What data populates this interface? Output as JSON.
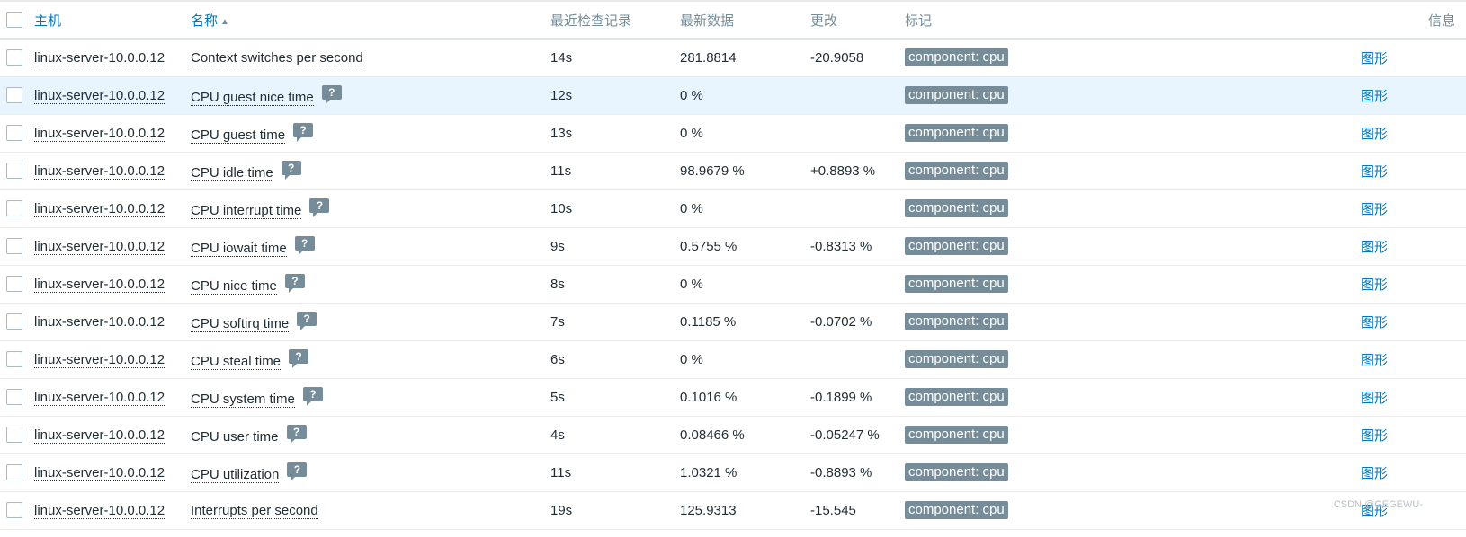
{
  "colors": {
    "link": "#0275b8",
    "header_text": "#768d99",
    "tag_bg": "#768d99",
    "row_hover": "#e8f5ff",
    "text": "#1f2c33"
  },
  "table": {
    "headers": {
      "host": "主机",
      "name": "名称",
      "name_sort_arrow": "▲",
      "last_check": "最近检查记录",
      "last_value": "最新数据",
      "change": "更改",
      "tags": "标记",
      "info": "信息"
    },
    "rows": [
      {
        "host": "linux-server-10.0.0.12",
        "name": "Context switches per second",
        "has_hint": false,
        "last_check": "14s",
        "last_value": "281.8814",
        "change": "-20.9058",
        "tag": "component: cpu",
        "graph": "图形"
      },
      {
        "host": "linux-server-10.0.0.12",
        "name": "CPU guest nice time",
        "has_hint": true,
        "last_check": "12s",
        "last_value": "0 %",
        "change": "",
        "tag": "component: cpu",
        "graph": "图形"
      },
      {
        "host": "linux-server-10.0.0.12",
        "name": "CPU guest time",
        "has_hint": true,
        "last_check": "13s",
        "last_value": "0 %",
        "change": "",
        "tag": "component: cpu",
        "graph": "图形"
      },
      {
        "host": "linux-server-10.0.0.12",
        "name": "CPU idle time",
        "has_hint": true,
        "last_check": "11s",
        "last_value": "98.9679 %",
        "change": "+0.8893 %",
        "tag": "component: cpu",
        "graph": "图形"
      },
      {
        "host": "linux-server-10.0.0.12",
        "name": "CPU interrupt time",
        "has_hint": true,
        "last_check": "10s",
        "last_value": "0 %",
        "change": "",
        "tag": "component: cpu",
        "graph": "图形"
      },
      {
        "host": "linux-server-10.0.0.12",
        "name": "CPU iowait time",
        "has_hint": true,
        "last_check": "9s",
        "last_value": "0.5755 %",
        "change": "-0.8313 %",
        "tag": "component: cpu",
        "graph": "图形"
      },
      {
        "host": "linux-server-10.0.0.12",
        "name": "CPU nice time",
        "has_hint": true,
        "last_check": "8s",
        "last_value": "0 %",
        "change": "",
        "tag": "component: cpu",
        "graph": "图形"
      },
      {
        "host": "linux-server-10.0.0.12",
        "name": "CPU softirq time",
        "has_hint": true,
        "last_check": "7s",
        "last_value": "0.1185 %",
        "change": "-0.0702 %",
        "tag": "component: cpu",
        "graph": "图形"
      },
      {
        "host": "linux-server-10.0.0.12",
        "name": "CPU steal time",
        "has_hint": true,
        "last_check": "6s",
        "last_value": "0 %",
        "change": "",
        "tag": "component: cpu",
        "graph": "图形"
      },
      {
        "host": "linux-server-10.0.0.12",
        "name": "CPU system time",
        "has_hint": true,
        "last_check": "5s",
        "last_value": "0.1016 %",
        "change": "-0.1899 %",
        "tag": "component: cpu",
        "graph": "图形"
      },
      {
        "host": "linux-server-10.0.0.12",
        "name": "CPU user time",
        "has_hint": true,
        "last_check": "4s",
        "last_value": "0.08466 %",
        "change": "-0.05247 %",
        "tag": "component: cpu",
        "graph": "图形"
      },
      {
        "host": "linux-server-10.0.0.12",
        "name": "CPU utilization",
        "has_hint": true,
        "last_check": "11s",
        "last_value": "1.0321 %",
        "change": "-0.8893 %",
        "tag": "component: cpu",
        "graph": "图形"
      },
      {
        "host": "linux-server-10.0.0.12",
        "name": "Interrupts per second",
        "has_hint": false,
        "last_check": "19s",
        "last_value": "125.9313",
        "change": "-15.545",
        "tag": "component: cpu",
        "graph": "图形"
      }
    ]
  },
  "watermark": "CSDN @GEGEWU-"
}
